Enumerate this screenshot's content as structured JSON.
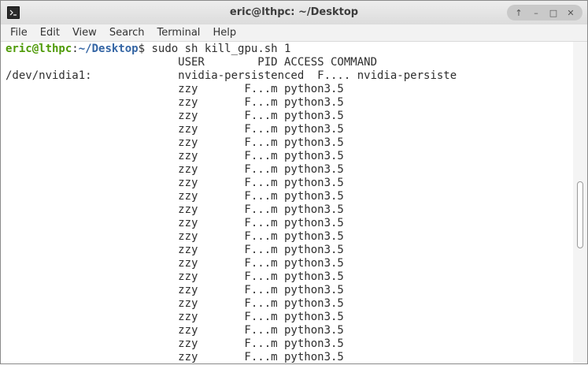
{
  "window": {
    "title": "eric@lthpc: ~/Desktop",
    "controls": [
      "↑",
      "–",
      "□",
      "✕"
    ]
  },
  "menu": [
    "File",
    "Edit",
    "View",
    "Search",
    "Terminal",
    "Help"
  ],
  "prompt": {
    "user_host": "eric@lthpc",
    "separator": ":",
    "path": "~/Desktop",
    "symbol": "$",
    "command": " sudo sh kill_gpu.sh 1"
  },
  "output": {
    "header": "                          USER        PID ACCESS COMMAND",
    "device_line": "/dev/nvidia1:             nvidia-persistenced  F.... nvidia-persiste",
    "process_lines": [
      "                          zzy       F...m python3.5",
      "                          zzy       F...m python3.5",
      "                          zzy       F...m python3.5",
      "                          zzy       F...m python3.5",
      "                          zzy       F...m python3.5",
      "                          zzy       F...m python3.5",
      "                          zzy       F...m python3.5",
      "                          zzy       F...m python3.5",
      "                          zzy       F...m python3.5",
      "                          zzy       F...m python3.5",
      "                          zzy       F...m python3.5",
      "                          zzy       F...m python3.5",
      "                          zzy       F...m python3.5",
      "                          zzy       F...m python3.5",
      "                          zzy       F...m python3.5",
      "                          zzy       F...m python3.5",
      "                          zzy       F...m python3.5",
      "                          zzy       F...m python3.5",
      "                          zzy       F...m python3.5",
      "                          zzy       F...m python3.5",
      "                          zzy       F...m python3.5"
    ]
  },
  "colors": {
    "prompt_user": "#4e9a06",
    "prompt_path": "#3465a4",
    "text": "#2e2e2e"
  }
}
